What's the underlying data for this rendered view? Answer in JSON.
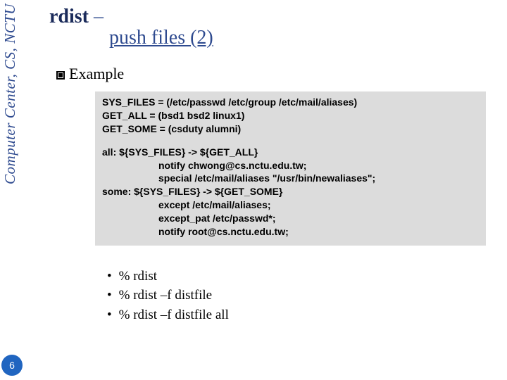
{
  "sidebar": "Computer Center, CS, NCTU",
  "title": {
    "command": "rdist",
    "sep": " – ",
    "line2": "push files (2)"
  },
  "section_heading": "Example",
  "code": {
    "l1": "SYS_FILES = (/etc/passwd /etc/group /etc/mail/aliases)",
    "l2": "GET_ALL = (bsd1 bsd2 linux1)",
    "l3": "GET_SOME = (csduty alumni)",
    "l4": "all: ${SYS_FILES} -> ${GET_ALL}",
    "l5": "notify chwong@cs.nctu.edu.tw;",
    "l6": "special /etc/mail/aliases \"/usr/bin/newaliases\";",
    "l7": "some: ${SYS_FILES} -> ${GET_SOME}",
    "l8": "except /etc/mail/aliases;",
    "l9": "except_pat /etc/passwd*;",
    "l10": "notify root@cs.nctu.edu.tw;"
  },
  "commands": {
    "c1": "% rdist",
    "c2": "% rdist –f distfile",
    "c3": "% rdist –f distfile all"
  },
  "page_number": "6"
}
